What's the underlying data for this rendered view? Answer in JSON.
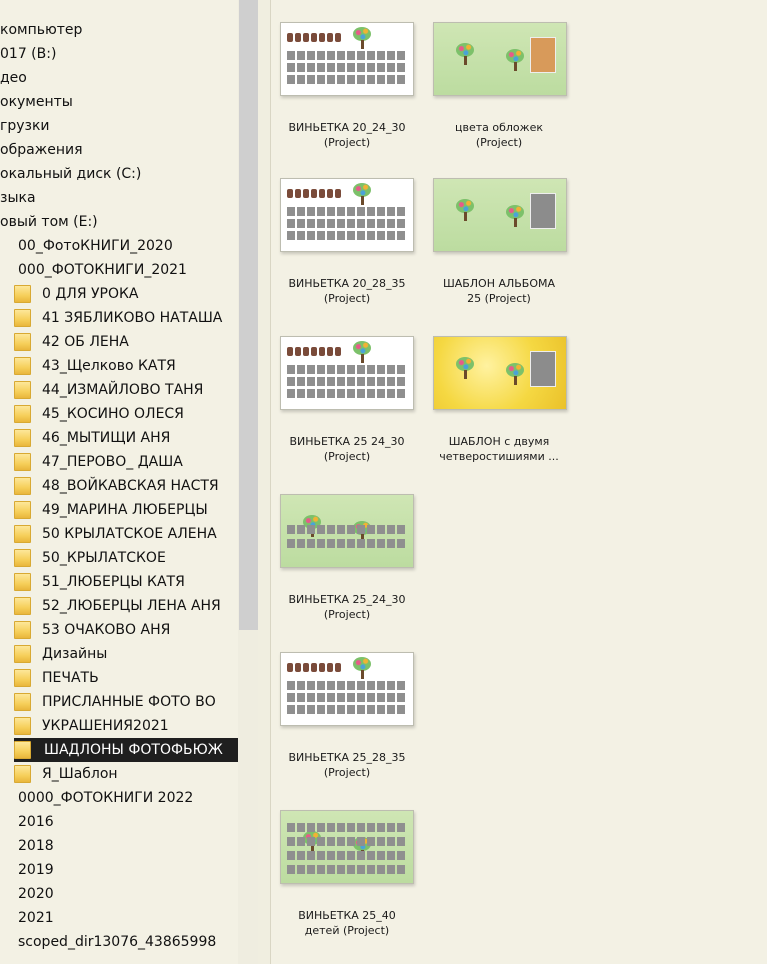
{
  "tree": {
    "items": [
      {
        "label": "компьютер",
        "indent": 0,
        "folder": false
      },
      {
        "label": "017 (B:)",
        "indent": 0,
        "folder": false
      },
      {
        "label": "део",
        "indent": 0,
        "folder": false
      },
      {
        "label": "окументы",
        "indent": 0,
        "folder": false
      },
      {
        "label": "грузки",
        "indent": 0,
        "folder": false
      },
      {
        "label": "ображения",
        "indent": 0,
        "folder": false
      },
      {
        "label": "окальный диск (C:)",
        "indent": 0,
        "folder": false
      },
      {
        "label": "зыка",
        "indent": 0,
        "folder": false
      },
      {
        "label": "овый том (E:)",
        "indent": 0,
        "folder": false
      },
      {
        "label": "00_ФотоКНИГИ_2020",
        "indent": 1,
        "folder": false
      },
      {
        "label": "000_ФОТОКНИГИ_2021",
        "indent": 1,
        "folder": false
      },
      {
        "label": "0 ДЛЯ УРОКА",
        "indent": 2,
        "folder": true
      },
      {
        "label": "41 ЗЯБЛИКОВО НАТАША",
        "indent": 2,
        "folder": true
      },
      {
        "label": "42 ОБ ЛЕНА",
        "indent": 2,
        "folder": true
      },
      {
        "label": "43_Щелково КАТЯ",
        "indent": 2,
        "folder": true
      },
      {
        "label": "44_ИЗМАЙЛОВО ТАНЯ",
        "indent": 2,
        "folder": true
      },
      {
        "label": "45_КОСИНО ОЛЕСЯ",
        "indent": 2,
        "folder": true
      },
      {
        "label": "46_МЫТИЩИ АНЯ",
        "indent": 2,
        "folder": true
      },
      {
        "label": "47_ПЕРОВО_ ДАША",
        "indent": 2,
        "folder": true
      },
      {
        "label": "48_ВОЙКАВСКАЯ НАСТЯ",
        "indent": 2,
        "folder": true
      },
      {
        "label": "49_МАРИНА ЛЮБЕРЦЫ",
        "indent": 2,
        "folder": true
      },
      {
        "label": "50 КРЫЛАТСКОЕ АЛЕНА",
        "indent": 2,
        "folder": true
      },
      {
        "label": "50_КРЫЛАТСКОЕ",
        "indent": 2,
        "folder": true
      },
      {
        "label": "51_ЛЮБЕРЦЫ КАТЯ",
        "indent": 2,
        "folder": true
      },
      {
        "label": "52_ЛЮБЕРЦЫ ЛЕНА АНЯ",
        "indent": 2,
        "folder": true
      },
      {
        "label": "53 ОЧАКОВО АНЯ",
        "indent": 2,
        "folder": true
      },
      {
        "label": "Дизайны",
        "indent": 2,
        "folder": true
      },
      {
        "label": "ПЕЧАТЬ",
        "indent": 2,
        "folder": true
      },
      {
        "label": "ПРИСЛАННЫЕ ФОТО ВО",
        "indent": 2,
        "folder": true
      },
      {
        "label": "УКРАШЕНИЯ2021",
        "indent": 2,
        "folder": true
      },
      {
        "label": "ШАДЛОНЫ ФОТОФЬЮЖ",
        "indent": 2,
        "folder": true,
        "selected": true
      },
      {
        "label": "Я_Шаблон",
        "indent": 2,
        "folder": true
      },
      {
        "label": "0000_ФОТОКНИГИ 2022",
        "indent": 1,
        "folder": false
      },
      {
        "label": "2016",
        "indent": 1,
        "folder": false
      },
      {
        "label": "2018",
        "indent": 1,
        "folder": false
      },
      {
        "label": "2019",
        "indent": 1,
        "folder": false
      },
      {
        "label": "2020",
        "indent": 1,
        "folder": false
      },
      {
        "label": "2021",
        "indent": 1,
        "folder": false
      },
      {
        "label": "scoped_dir13076_43865998",
        "indent": 1,
        "folder": false
      }
    ]
  },
  "files": [
    {
      "line1": "ВИНЬЕТКА 20_24_30",
      "line2": "(Project)",
      "style": "white"
    },
    {
      "line1": "цвета обложек",
      "line2": "(Project)",
      "style": "green"
    },
    {
      "line1": "ВИНЬЕТКА 20_28_35",
      "line2": "(Project)",
      "style": "white"
    },
    {
      "line1": "ШАБЛОН АЛЬБОМА",
      "line2": "25 (Project)",
      "style": "green"
    },
    {
      "line1": "ВИНЬЕТКА 25 24_30",
      "line2": "(Project)",
      "style": "white"
    },
    {
      "line1": "ШАБЛОН с двумя",
      "line2": "четверостишиями ...",
      "style": "yellow"
    },
    {
      "line1": "ВИНЬЕТКА 25_24_30",
      "line2": "(Project)",
      "style": "green"
    },
    {
      "line1": "ВИНЬЕТКА 25_28_35",
      "line2": "(Project)",
      "style": "white"
    },
    {
      "line1": "ВИНЬЕТКА 25_40",
      "line2": "детей (Project)",
      "style": "green"
    }
  ]
}
